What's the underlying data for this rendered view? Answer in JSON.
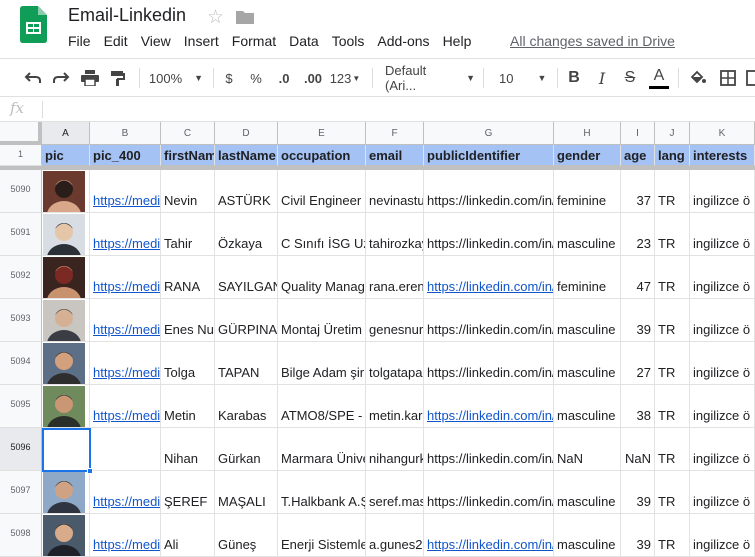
{
  "doc": {
    "title": "Email-Linkedin",
    "status": "All changes saved in Drive"
  },
  "menu": [
    "File",
    "Edit",
    "View",
    "Insert",
    "Format",
    "Data",
    "Tools",
    "Add-ons",
    "Help"
  ],
  "toolbar": {
    "zoom": "100%",
    "currency": "$",
    "percent": "%",
    "decrease_decimals": ".0",
    "increase_decimals": ".00",
    "more_formats": "123",
    "font": "Default (Ari...",
    "font_size": "10",
    "bold": "B",
    "italic": "I",
    "strike": "S",
    "text_color": "A"
  },
  "formula_bar": {
    "fx": "fx",
    "value": ""
  },
  "columns": [
    "A",
    "B",
    "C",
    "D",
    "E",
    "F",
    "G",
    "H",
    "I",
    "J",
    "K"
  ],
  "header_row_number": "1",
  "headers": [
    "pic",
    "pic_400",
    "firstName",
    "lastName",
    "occupation",
    "email",
    "publicIdentifier",
    "gender",
    "age",
    "lang",
    "interests"
  ],
  "rows": [
    {
      "num": "5090",
      "pic_400": "https://media",
      "firstName": "Nevin",
      "lastName": "ASTÜRK",
      "occupation": "Civil Engineer",
      "email": "nevinasturk",
      "publicIdentifier": "https://linkedin.com/in/",
      "pid_link": false,
      "gender": "feminine",
      "age": "37",
      "lang": "TR",
      "interests": "ingilizce ö"
    },
    {
      "num": "5091",
      "pic_400": "https://media",
      "firstName": "Tahir",
      "lastName": "Özkaya",
      "occupation": "C Sınıfı İSG Uzmanı",
      "email": "tahirozkaya",
      "publicIdentifier": "https://linkedin.com/in/",
      "pid_link": false,
      "gender": "masculine",
      "age": "23",
      "lang": "TR",
      "interests": "ingilizce ö"
    },
    {
      "num": "5092",
      "pic_400": "https://media",
      "firstName": "RANA",
      "lastName": "SAYILGAN",
      "occupation": "Quality Management",
      "email": "rana.eren",
      "publicIdentifier": "https://linkedin.com/in/",
      "pid_link": true,
      "gender": "feminine",
      "age": "47",
      "lang": "TR",
      "interests": "ingilizce ö"
    },
    {
      "num": "5093",
      "pic_400": "https://media",
      "firstName": "Enes Nuri",
      "lastName": "GÜRPINAR",
      "occupation": "Montaj Üretim",
      "email": "genesnuri",
      "publicIdentifier": "https://linkedin.com/in/",
      "pid_link": false,
      "gender": "masculine",
      "age": "39",
      "lang": "TR",
      "interests": "ingilizce ö"
    },
    {
      "num": "5094",
      "pic_400": "https://media",
      "firstName": "Tolga",
      "lastName": "TAPAN",
      "occupation": "Bilge Adam şirketi",
      "email": "tolgatapan",
      "publicIdentifier": "https://linkedin.com/in/",
      "pid_link": false,
      "gender": "masculine",
      "age": "27",
      "lang": "TR",
      "interests": "ingilizce ö"
    },
    {
      "num": "5095",
      "pic_400": "https://media",
      "firstName": "Metin",
      "lastName": "Karabas",
      "occupation": "ATMO8/SPE -",
      "email": "metin.karabas",
      "publicIdentifier": "https://linkedin.com/in/",
      "pid_link": true,
      "gender": "masculine",
      "age": "38",
      "lang": "TR",
      "interests": "ingilizce ö"
    },
    {
      "num": "5096",
      "pic_400": "",
      "firstName": "Nihan",
      "lastName": "Gürkan",
      "occupation": "Marmara Üniversitesi",
      "email": "nihangurkan",
      "publicIdentifier": "https://linkedin.com/in/",
      "pid_link": false,
      "gender": "NaN",
      "age": "NaN",
      "lang": "TR",
      "interests": "ingilizce ö"
    },
    {
      "num": "5097",
      "pic_400": "https://media",
      "firstName": "ŞEREF",
      "lastName": "MAŞALI",
      "occupation": "T.Halkbank A.Ş.",
      "email": "seref.masali",
      "publicIdentifier": "https://linkedin.com/in/",
      "pid_link": false,
      "gender": "masculine",
      "age": "39",
      "lang": "TR",
      "interests": "ingilizce ö"
    },
    {
      "num": "5098",
      "pic_400": "https://media",
      "firstName": "Ali",
      "lastName": "Güneş",
      "occupation": "Enerji Sistemleri",
      "email": "a.gunes2",
      "publicIdentifier": "https://linkedin.com/in/",
      "pid_link": true,
      "gender": "masculine",
      "age": "39",
      "lang": "TR",
      "interests": "ingilizce ö"
    }
  ],
  "colors": {
    "header_fill": "#a4c2f4",
    "link": "#1155cc",
    "selection": "#1a73e8",
    "logo_green": "#0f9d58"
  }
}
